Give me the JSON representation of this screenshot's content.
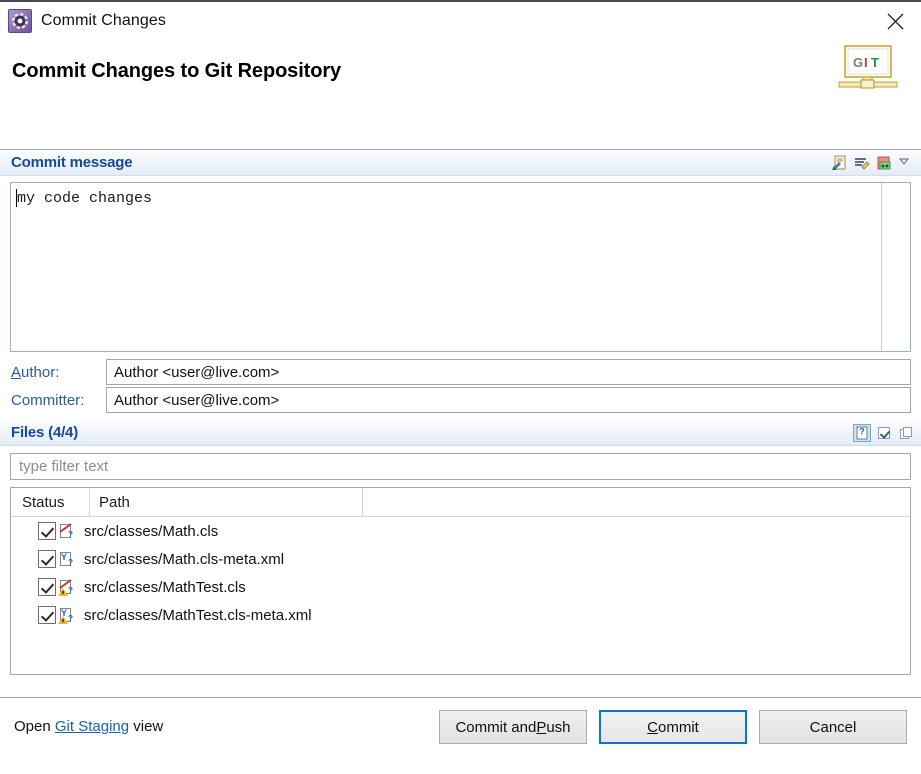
{
  "window": {
    "title": "Commit Changes",
    "icon": "gear-icon",
    "close_label": "×"
  },
  "banner": {
    "heading": "Commit Changes to Git Repository",
    "logo_letters": [
      "G",
      "I",
      "T"
    ],
    "logo_colors": [
      "#7c7c7c",
      "#c0392b",
      "#27934a"
    ]
  },
  "commit_message": {
    "section_label": "Commit message",
    "value": "my code changes",
    "tools": [
      {
        "name": "add-signed-off-icon"
      },
      {
        "name": "amend-commit-icon"
      },
      {
        "name": "add-change-id-icon"
      },
      {
        "name": "chevron-down-icon"
      }
    ]
  },
  "author": {
    "label_prefix": "",
    "label_mnemonic": "A",
    "label_rest": "uthor:",
    "value": "Author <user@live.com>"
  },
  "committer": {
    "label": "Committer:",
    "value": "Author <user@live.com>"
  },
  "files": {
    "section_label": "Files (4/4)",
    "tools": [
      {
        "name": "show-untracked-files-icon",
        "selected": true
      },
      {
        "name": "select-all-icon",
        "selected": false
      },
      {
        "name": "copy-paths-icon",
        "selected": false
      }
    ],
    "filter_placeholder": "type filter text",
    "columns": [
      "Status",
      "Path"
    ],
    "rows": [
      {
        "checked": true,
        "icon": "modified-apex-class-icon",
        "glyph": "X",
        "warn": false,
        "path": "src/classes/Math.cls"
      },
      {
        "checked": true,
        "icon": "modified-xml-file-icon",
        "glyph": "Y",
        "warn": false,
        "path": "src/classes/Math.cls-meta.xml"
      },
      {
        "checked": true,
        "icon": "warning-apex-class-icon",
        "glyph": "X",
        "warn": true,
        "path": "src/classes/MathTest.cls"
      },
      {
        "checked": true,
        "icon": "warning-xml-file-icon",
        "glyph": "Y",
        "warn": true,
        "path": "src/classes/MathTest.cls-meta.xml"
      }
    ]
  },
  "footer": {
    "staging_prefix": "Open ",
    "staging_link": "Git Staging",
    "staging_suffix": " view",
    "buttons": [
      {
        "name": "commit-and-push-button",
        "pre": "Commit and ",
        "mnemonic": "P",
        "post": "ush",
        "default": false
      },
      {
        "name": "commit-button",
        "pre": "",
        "mnemonic": "C",
        "post": "ommit",
        "default": true
      },
      {
        "name": "cancel-button",
        "pre": "Cancel",
        "mnemonic": "",
        "post": "",
        "default": false
      }
    ]
  },
  "colors": {
    "section_header_text": "#16499b",
    "link": "#1d5fa8",
    "default_button_border": "#0a74d1",
    "label_blue": "#2c5aa0"
  }
}
